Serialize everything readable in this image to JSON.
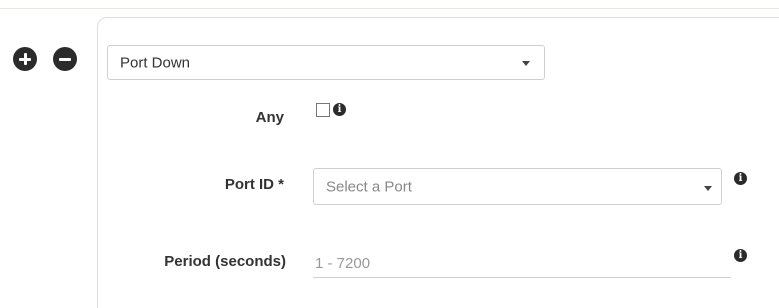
{
  "event_type": {
    "selected": "Port Down"
  },
  "fields": {
    "any": {
      "label": "Any",
      "checked": false,
      "info_glyph": "i"
    },
    "port_id": {
      "label": "Port ID *",
      "placeholder": "Select a Port",
      "info_glyph": "i"
    },
    "period": {
      "label": "Period (seconds)",
      "placeholder": "1 - 7200",
      "value": "",
      "info_glyph": "i"
    }
  },
  "icons": {
    "add": "plus-circle-icon",
    "remove": "minus-circle-icon",
    "info": "info-circle-icon",
    "dropdown": "caret-down-icon"
  },
  "colors": {
    "icon_fill": "#2b2b2b",
    "border": "#cfcfcf",
    "placeholder_text": "#999999"
  }
}
